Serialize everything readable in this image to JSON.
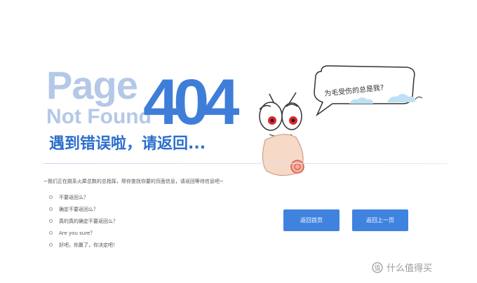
{
  "hero": {
    "page": "Page",
    "not_found": "Not Found",
    "code": "404",
    "headline": "遇到错误啦，请返回..."
  },
  "bubble": {
    "text": "为毛受伤的总是我?"
  },
  "intro": "~我们正在跳系火犀总数的总指挥，帮你查找你要的页面信息，请返回等待信息吧~",
  "options": [
    "不要返回么？",
    "确定不要返回么？",
    "真的真的确定不要返回么？",
    "Are you sure？",
    "好吧，你赢了，你决定吧！"
  ],
  "buttons": {
    "home": "返回首页",
    "back": "返回上一页"
  },
  "watermark": {
    "icon": "zhidemai-logo-icon",
    "text": "什么值得买"
  },
  "colors": {
    "accent": "#3f83df",
    "title_light": "#b4c8e8",
    "title_dark": "#3f7ed8"
  }
}
